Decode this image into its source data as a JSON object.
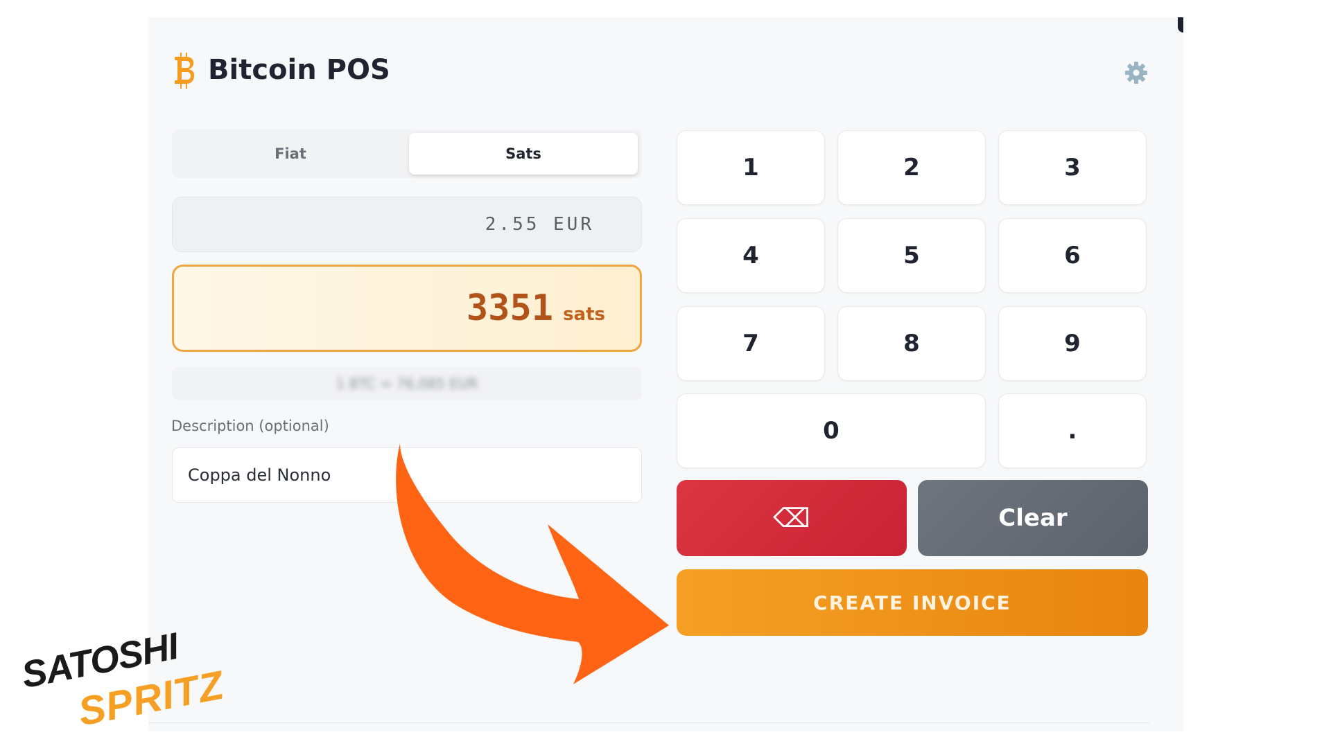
{
  "header": {
    "title": "Bitcoin POS",
    "logo_icon": "bitcoin-logo-icon",
    "settings_icon": "gear-icon"
  },
  "mode_toggle": {
    "fiat_label": "Fiat",
    "sats_label": "Sats",
    "selected": "Sats"
  },
  "amount": {
    "fiat_value": "2.55 EUR",
    "sats_value": "3351",
    "sats_unit": "sats",
    "rate_text": "1 BTC = 76,085 EUR"
  },
  "description": {
    "label": "Description (optional)",
    "value": "Coppa del Nonno"
  },
  "keypad": {
    "k1": "1",
    "k2": "2",
    "k3": "3",
    "k4": "4",
    "k5": "5",
    "k6": "6",
    "k7": "7",
    "k8": "8",
    "k9": "9",
    "k0": "0",
    "kdot": ".",
    "backspace_label": "⌫",
    "backspace_icon": "backspace-icon",
    "clear_label": "Clear"
  },
  "actions": {
    "create_invoice_label": "CREATE INVOICE"
  },
  "overlay": {
    "arrow_icon": "arrow-icon",
    "arrow_color": "#ff6314",
    "brand_line_1": "SATOSHI",
    "brand_line_2": "SPRITZ"
  },
  "colors": {
    "accent": "#f39c1f",
    "backspace": "#d32b3a",
    "clear": "#656c75",
    "sats_text": "#b0541c"
  }
}
